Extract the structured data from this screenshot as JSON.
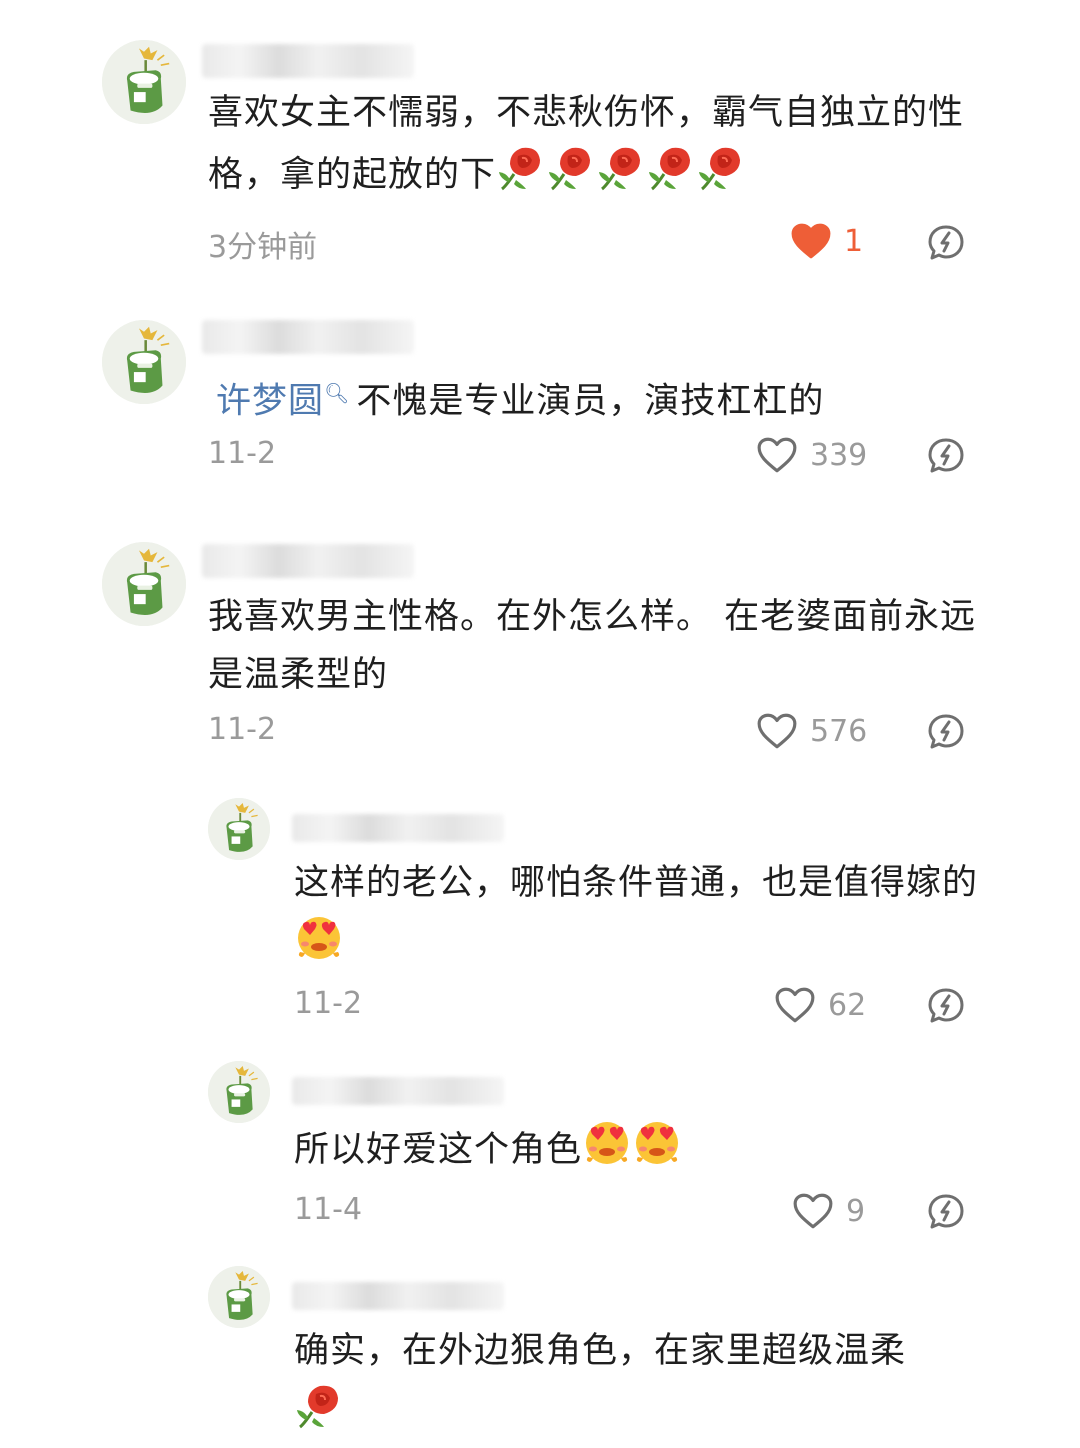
{
  "comments": [
    {
      "text": "喜欢女主不懦弱，不悲秋伤怀，霸气自独立的性格，拿的起放的下",
      "emoji_names": [
        "rose-emoji",
        "rose-emoji",
        "rose-emoji",
        "rose-emoji",
        "rose-emoji"
      ],
      "time": "3分钟前",
      "likes": "1",
      "liked": true
    },
    {
      "mention": "许梦圆",
      "text": "不愧是专业演员，演技杠杠的",
      "time": "11-2",
      "likes": "339",
      "liked": false
    },
    {
      "text": "我喜欢男主性格。在外怎么样。 在老婆面前永远是温柔型的",
      "time": "11-2",
      "likes": "576",
      "liked": false
    }
  ],
  "replies": [
    {
      "text": "这样的老公，哪怕条件普通，也是值得嫁的",
      "emoji_names": [
        "heart-eyes-emoji"
      ],
      "time": "11-2",
      "likes": "62"
    },
    {
      "text": "所以好爱这个角色",
      "emoji_names": [
        "heart-eyes-emoji",
        "heart-eyes-emoji"
      ],
      "time": "11-4",
      "likes": "9"
    },
    {
      "text": "确实，在外边狠角色，在家里超级温柔",
      "emoji_names": [
        "rose-emoji"
      ]
    }
  ],
  "colors": {
    "liked_heart": "#ee5e37",
    "mention": "#4f7ab0",
    "meta_gray": "#9a9a9a"
  },
  "icons": {
    "like": "heart-icon",
    "reply": "reply-bubble-icon",
    "search": "search-icon"
  }
}
